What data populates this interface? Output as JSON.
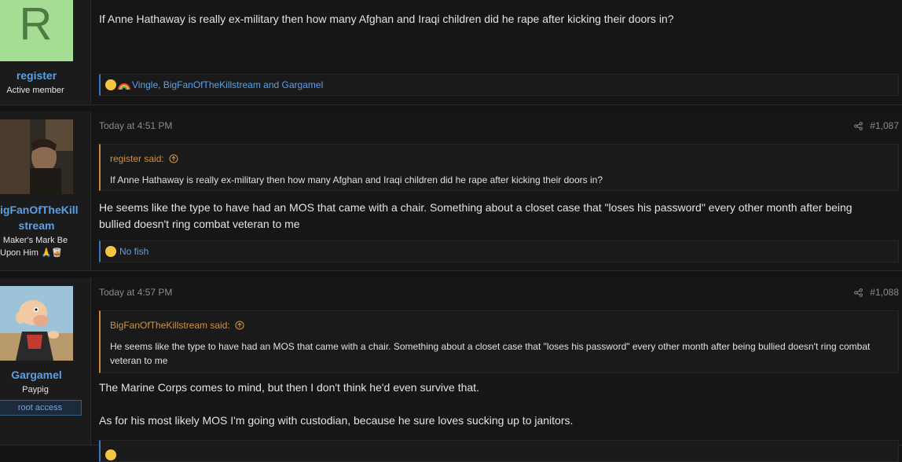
{
  "posts": [
    {
      "author": "register",
      "user_title": "Active member",
      "avatar_letter": "R",
      "body": "If Anne Hathaway is really ex-military then how many Afghan and Iraqi children did he rape after kicking their doors in?",
      "reactions": "Vingle, BigFanOfTheKillstream and Gargamel"
    },
    {
      "author": "BigFanOfTheKillstream",
      "author_display_line1": "igFanOfTheKill",
      "author_display_line2": "stream",
      "user_title_line1": "Maker's Mark Be",
      "user_title_line2": "Upon Him 🙏🥃",
      "timestamp": "Today at 4:51 PM",
      "post_number": "#1,087",
      "quote_author": "register said:",
      "quote_text": "If Anne Hathaway is really ex-military then how many Afghan and Iraqi children did he rape after kicking their doors in?",
      "body": "He seems like the type to have had an MOS that came with a chair. Something about a closet case that \"loses his password\" every other month after being bullied doesn't ring combat veteran to me",
      "reactions": "No fish"
    },
    {
      "author": "Gargamel",
      "user_title": "Paypig",
      "user_banner": "root access",
      "timestamp": "Today at 4:57 PM",
      "post_number": "#1,088",
      "quote_author": "BigFanOfTheKillstream said:",
      "quote_text": "He seems like the type to have had an MOS that came with a chair. Something about a closet case that \"loses his password\" every other month after being bullied doesn't ring combat veteran to me",
      "body_p1": "The Marine Corps comes to mind, but then I don't think he'd even survive that.",
      "body_p2": "As for his most likely MOS I'm going with custodian, because he sure loves sucking up to janitors."
    }
  ],
  "colors": {
    "link": "#5aa0e6",
    "quote_accent": "#c88a3a",
    "reaction_accent": "#3b76c2",
    "avatar_green": "#a6dd94"
  },
  "icons": [
    "share-icon",
    "arrow-up-circle-icon",
    "thinking-emoji-icon",
    "rainbow-emoji-icon"
  ]
}
